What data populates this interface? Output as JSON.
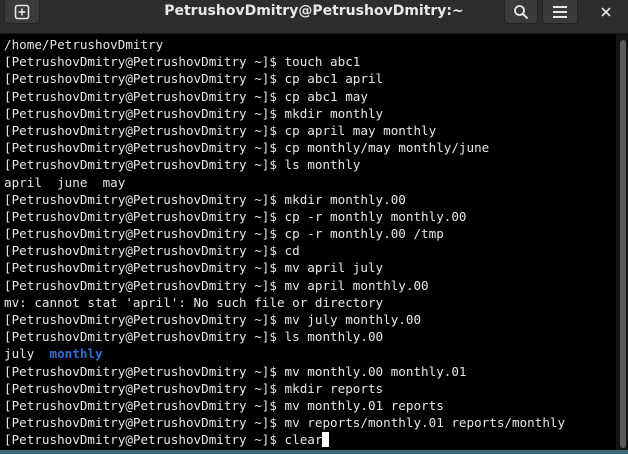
{
  "window": {
    "title": "PetrushovDmitry@PetrushovDmitry:~"
  },
  "icons": {
    "new_tab": "new-tab-icon",
    "search": "search-icon",
    "menu": "hamburger-menu-icon",
    "close": "close-icon"
  },
  "colors": {
    "background": "#000000",
    "text": "#e6e6e6",
    "directory": "#2f6fd4"
  },
  "terminal": {
    "prompt": "[PetrushovDmitry@PetrushovDmitry ~]$ ",
    "lines": [
      {
        "text": "/home/PetrushovDmitry"
      },
      {
        "prompt": "[PetrushovDmitry@PetrushovDmitry ~]$ ",
        "cmd": "touch abc1"
      },
      {
        "prompt": "[PetrushovDmitry@PetrushovDmitry ~]$ ",
        "cmd": "cp abc1 april"
      },
      {
        "prompt": "[PetrushovDmitry@PetrushovDmitry ~]$ ",
        "cmd": "cp abc1 may"
      },
      {
        "prompt": "[PetrushovDmitry@PetrushovDmitry ~]$ ",
        "cmd": "mkdir monthly"
      },
      {
        "prompt": "[PetrushovDmitry@PetrushovDmitry ~]$ ",
        "cmd": "cp april may monthly"
      },
      {
        "prompt": "[PetrushovDmitry@PetrushovDmitry ~]$ ",
        "cmd": "cp monthly/may monthly/june"
      },
      {
        "prompt": "[PetrushovDmitry@PetrushovDmitry ~]$ ",
        "cmd": "ls monthly"
      },
      {
        "text": "april  june  may"
      },
      {
        "prompt": "[PetrushovDmitry@PetrushovDmitry ~]$ ",
        "cmd": "mkdir monthly.00"
      },
      {
        "prompt": "[PetrushovDmitry@PetrushovDmitry ~]$ ",
        "cmd": "cp -r monthly monthly.00"
      },
      {
        "prompt": "[PetrushovDmitry@PetrushovDmitry ~]$ ",
        "cmd": "cp -r monthly.00 /tmp"
      },
      {
        "prompt": "[PetrushovDmitry@PetrushovDmitry ~]$ ",
        "cmd": "cd"
      },
      {
        "prompt": "[PetrushovDmitry@PetrushovDmitry ~]$ ",
        "cmd": "mv april july"
      },
      {
        "prompt": "[PetrushovDmitry@PetrushovDmitry ~]$ ",
        "cmd": "mv april monthly.00"
      },
      {
        "text": "mv: cannot stat 'april': No such file or directory"
      },
      {
        "prompt": "[PetrushovDmitry@PetrushovDmitry ~]$ ",
        "cmd": "mv july monthly.00"
      },
      {
        "prompt": "[PetrushovDmitry@PetrushovDmitry ~]$ ",
        "cmd": "ls monthly.00"
      },
      {
        "listing": [
          {
            "text": "july",
            "dir": false
          },
          {
            "text": "monthly",
            "dir": true
          }
        ]
      },
      {
        "prompt": "[PetrushovDmitry@PetrushovDmitry ~]$ ",
        "cmd": "mv monthly.00 monthly.01"
      },
      {
        "prompt": "[PetrushovDmitry@PetrushovDmitry ~]$ ",
        "cmd": "mkdir reports"
      },
      {
        "prompt": "[PetrushovDmitry@PetrushovDmitry ~]$ ",
        "cmd": "mv monthly.01 reports"
      },
      {
        "prompt": "[PetrushovDmitry@PetrushovDmitry ~]$ ",
        "cmd": "mv reports/monthly.01 reports/monthly"
      },
      {
        "prompt": "[PetrushovDmitry@PetrushovDmitry ~]$ ",
        "cmd": "clear",
        "cursor": true
      }
    ]
  }
}
